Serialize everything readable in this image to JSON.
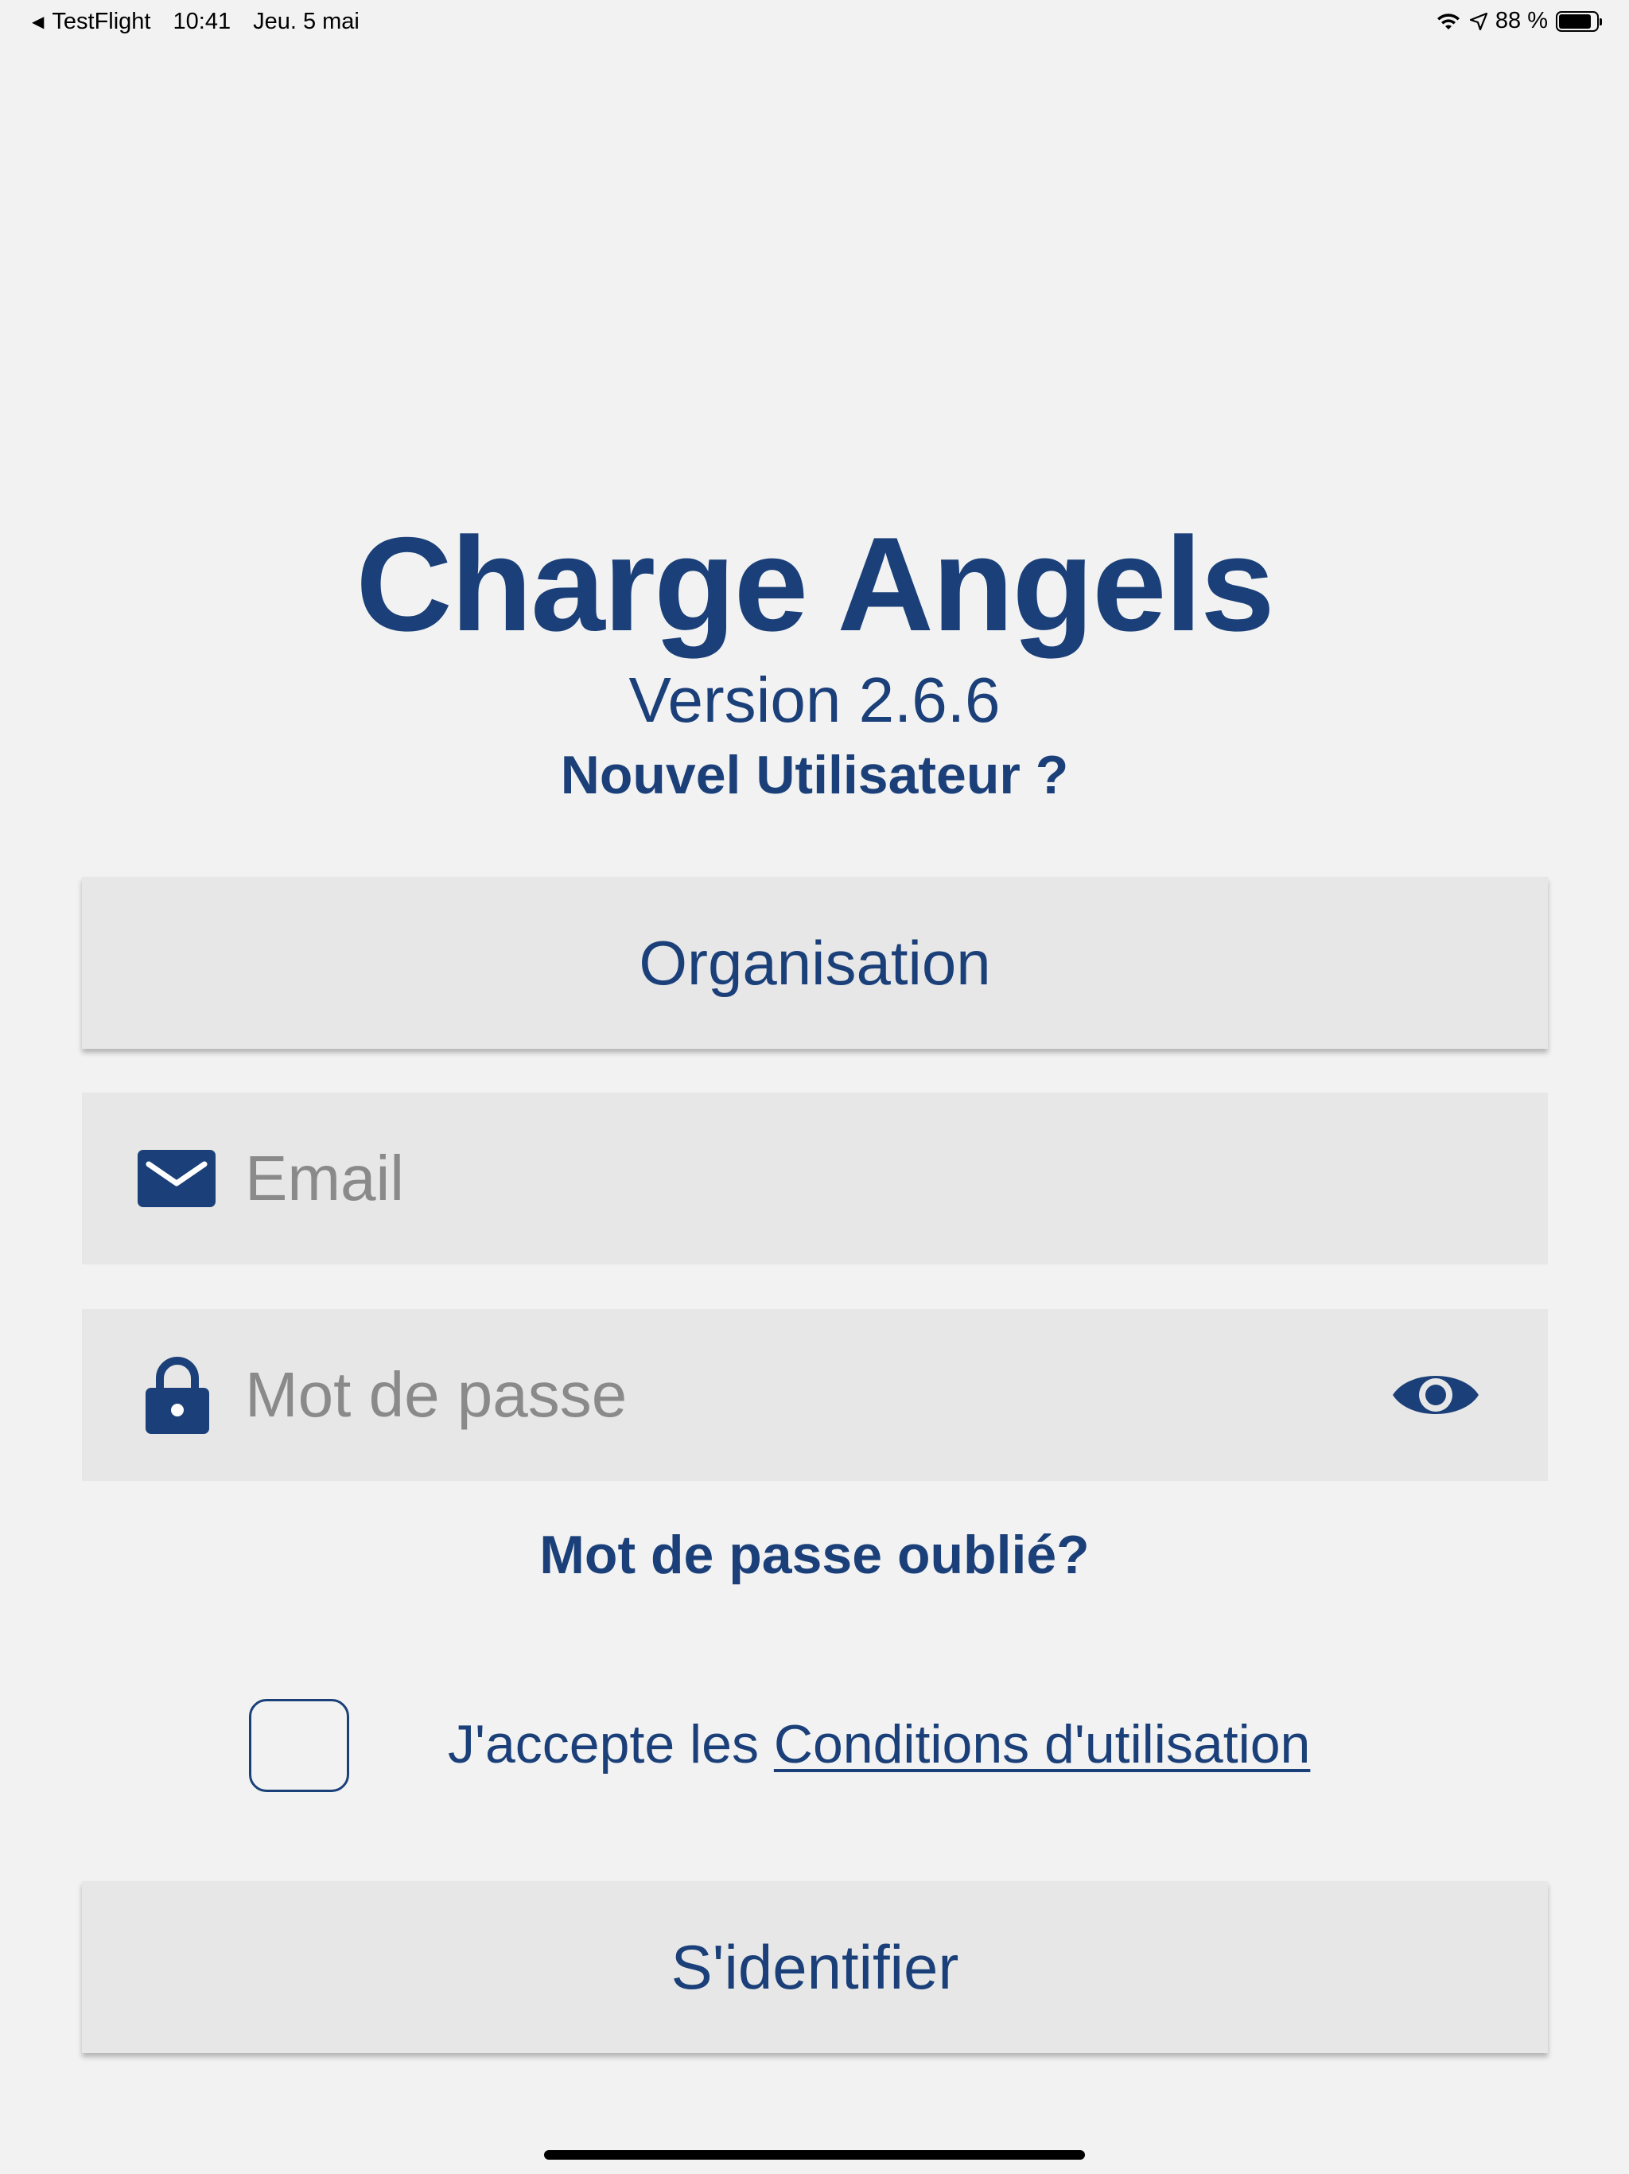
{
  "status_bar": {
    "back_app": "TestFlight",
    "time": "10:41",
    "date": "Jeu. 5 mai",
    "battery_percent": "88 %",
    "battery_level": 0.88
  },
  "header": {
    "title": "Charge Angels",
    "version": "Version 2.6.6",
    "new_user_link": "Nouvel Utilisateur ?"
  },
  "form": {
    "organisation_label": "Organisation",
    "email_placeholder": "Email",
    "password_placeholder": "Mot de passe",
    "forgot_password_link": "Mot de passe oublié?",
    "terms_prefix": "J'accepte les ",
    "terms_link": "Conditions d'utilisation",
    "terms_checked": false,
    "login_label": "S'identifier"
  },
  "colors": {
    "brand": "#1b4079",
    "background": "#f2f2f2",
    "field_background": "#e7e7e7",
    "placeholder": "#8a8a8a"
  },
  "icons": {
    "back": "back-arrow-icon",
    "wifi": "wifi-icon",
    "location": "location-arrow-icon",
    "battery": "battery-icon",
    "email": "envelope-icon",
    "password": "lock-icon",
    "show_password": "eye-icon"
  }
}
